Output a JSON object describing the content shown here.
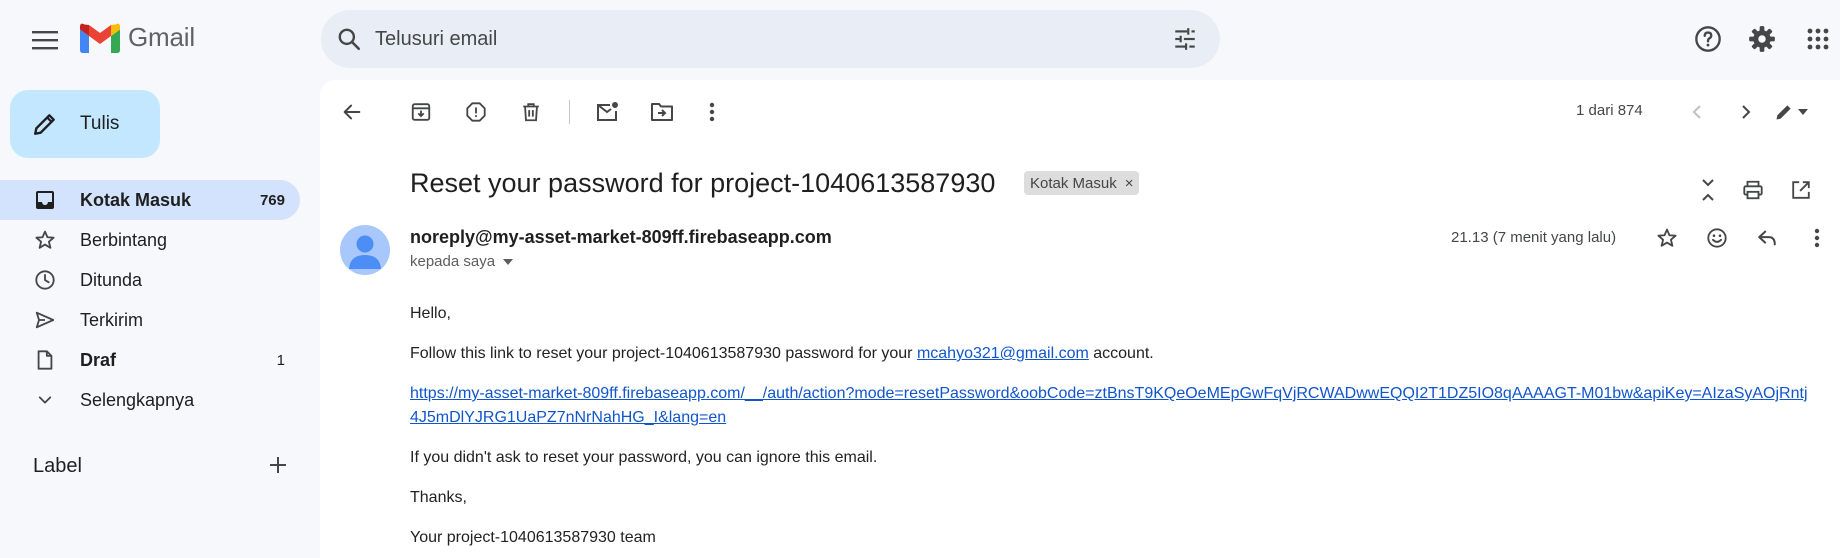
{
  "app": {
    "name": "Gmail"
  },
  "search": {
    "placeholder": "Telusuri email"
  },
  "compose": {
    "label": "Tulis"
  },
  "sidebar": {
    "items": [
      {
        "label": "Kotak Masuk",
        "count": "769"
      },
      {
        "label": "Berbintang",
        "count": ""
      },
      {
        "label": "Ditunda",
        "count": ""
      },
      {
        "label": "Terkirim",
        "count": ""
      },
      {
        "label": "Draf",
        "count": "1"
      },
      {
        "label": "Selengkapnya",
        "count": ""
      }
    ],
    "labels_header": "Label"
  },
  "toolbar": {
    "counter": "1 dari 874"
  },
  "email": {
    "subject": "Reset your password for project-1040613587930",
    "label_badge": "Kotak Masuk",
    "label_badge_remove": "×",
    "sender": "noreply@my-asset-market-809ff.firebaseapp.com",
    "to": "kepada saya",
    "time": "21.13 (7 menit yang lalu)",
    "greeting": "Hello,",
    "line1_before": "Follow this link to reset your project-1040613587930 password for your ",
    "line1_link": "mcahyo321@gmail.com",
    "line1_after": " account.",
    "reset_url": "https://my-asset-market-809ff.firebaseapp.com/__/auth/action?mode=resetPassword&oobCode=ztBnsT9KQeOeMEpGwFqVjRCWADwwEQQI2T1DZ5IO8qAAAAGT-M01bw&apiKey=AIzaSyAOjRntj4J5mDlYJRG1UaPZ7nNrNahHG_I&lang=en",
    "ignore_line": "If you didn't ask to reset your password, you can ignore this email.",
    "thanks": "Thanks,",
    "signature": "Your project-1040613587930 team"
  },
  "colors": {
    "background": "#f6f8fc",
    "compose_bg": "#c2e7ff",
    "nav_active_bg": "#d3e3fd",
    "link": "#1155cc",
    "avatar": "#a8c7fa"
  }
}
